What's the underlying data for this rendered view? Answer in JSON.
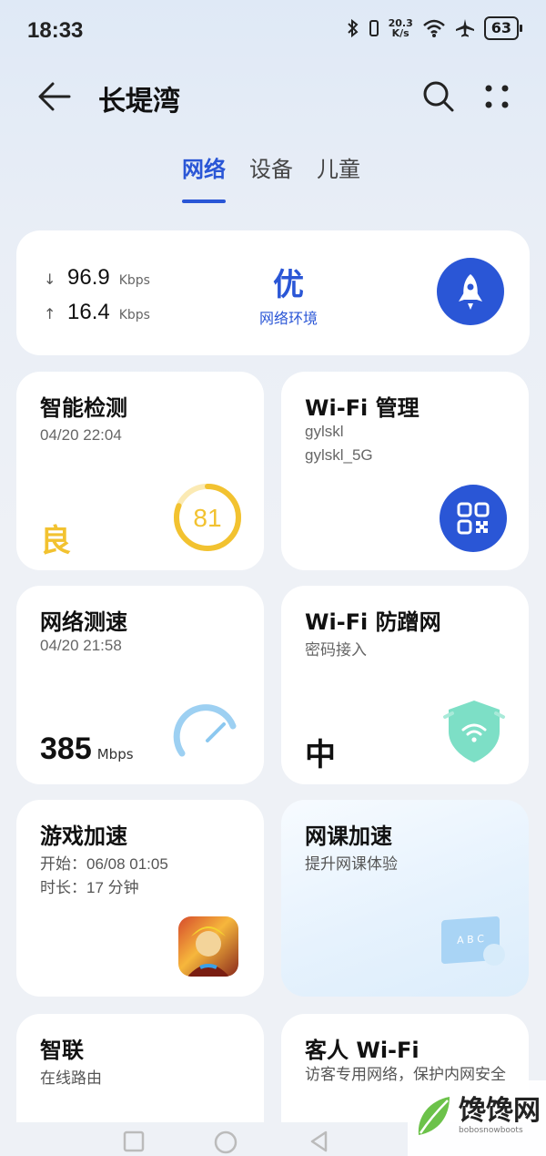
{
  "status_bar": {
    "time": "18:33",
    "net_speed_value": "20.3",
    "net_speed_unit": "K/s",
    "battery": "63"
  },
  "header": {
    "title": "长堤湾",
    "back_icon": "arrow-left-icon",
    "search_icon": "search-icon",
    "more_icon": "more-dots-icon"
  },
  "tabs": [
    {
      "label": "网络",
      "active": true
    },
    {
      "label": "设备",
      "active": false
    },
    {
      "label": "儿童",
      "active": false
    }
  ],
  "network": {
    "download_value": "96.9",
    "download_unit": "Kbps",
    "upload_value": "16.4",
    "upload_unit": "Kbps",
    "quality": "优",
    "quality_label": "网络环境"
  },
  "tiles": {
    "smart_check": {
      "title": "智能检测",
      "time": "04/20 22:04",
      "grade": "良",
      "score": "81",
      "score_fraction": 0.81
    },
    "wifi_manage": {
      "title": "Wi-Fi 管理",
      "ssid_1": "gylskl",
      "ssid_2": "gylskl_5G"
    },
    "speed_test": {
      "title": "网络测速",
      "time": "04/20 21:58",
      "speed": "385",
      "unit": "Mbps"
    },
    "anti_rub": {
      "title": "Wi-Fi 防蹭网",
      "sub": "密码接入",
      "level": "中"
    },
    "game_boost": {
      "title": "游戏加速",
      "start": "开始：06/08 01:05",
      "duration": "时长：17 分钟"
    },
    "class_boost": {
      "title": "网课加速",
      "sub": "提升网课体验",
      "board_text": "A B C"
    },
    "smart_link": {
      "title": "智联",
      "sub": "在线路由"
    },
    "guest_wifi": {
      "title": "客人 Wi-Fi",
      "sub": "访客专用网络，保护内网安全"
    }
  },
  "watermark": {
    "brand": "馋馋网",
    "domain": "bobosnowboots"
  },
  "colors": {
    "accent": "#2a56d6",
    "good": "#f2c230",
    "speed_arc": "#8cc8f0",
    "shield": "#6fdcc0"
  }
}
